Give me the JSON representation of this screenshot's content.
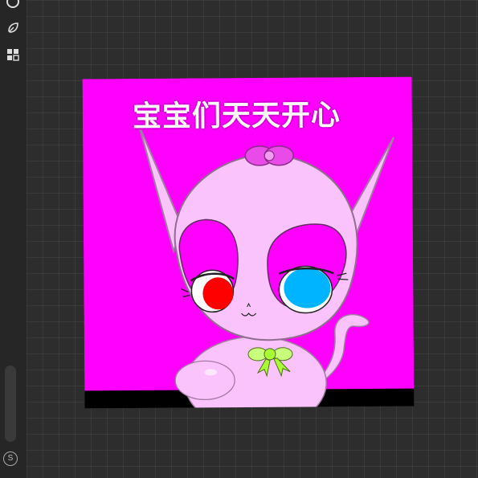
{
  "toolbar": {
    "tools": [
      {
        "icon": "circle-icon"
      },
      {
        "icon": "leaf-icon"
      },
      {
        "icon": "grid-icon"
      }
    ],
    "bottom_button_label": "S"
  },
  "artwork": {
    "caption": "宝宝们天天开心",
    "background_color": "#ff00ff",
    "cat_color": "#fbc3fb",
    "left_eye_color": "#ff0000",
    "right_eye_color": "#00b4ff",
    "bow_color": "#e94be9",
    "collar_bow_color": "#a7ff33"
  }
}
